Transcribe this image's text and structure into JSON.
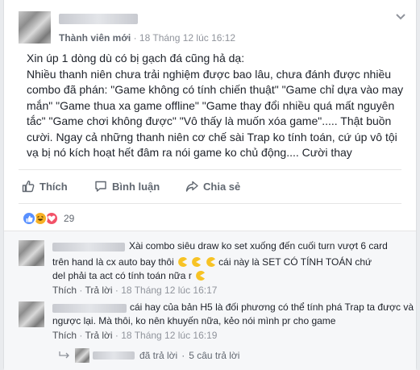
{
  "post": {
    "member_badge": "Thành viên mới",
    "timestamp": "· 18 Tháng 12 lúc 16:12",
    "lines": [
      "Xin úp 1 dòng dù có bị gạch đá cũng hả dạ:",
      "Nhiều thanh niên chưa trải nghiệm được bao lâu, chưa đánh được nhiều",
      "combo đã phán: \"Game không có tính chiến thuật\" \"Game chỉ dựa vào may",
      "mắn\" \"Game thua xa game offline\" \"Game thay đổi nhiều quá mất nguyên",
      "tắc\" \"Game chơi không được\" \"Vô thấy là muốn xóa game\"..... Thật buồn",
      "cười. Ngay cả những thanh niên cơ chế sài Trap ko tính toán, cứ úp vô tội",
      "vạ bị nó kích hoạt hết đâm ra nói game ko chủ động.... Cười thay"
    ]
  },
  "actions": {
    "like": "Thích",
    "comment": "Bình luận",
    "share": "Chia sẻ"
  },
  "reactions": {
    "count": "29",
    "colors": {
      "like": "#5890ff",
      "haha": "#f7b125",
      "love": "#f25268"
    }
  },
  "comments": [
    {
      "line1": "Xài combo siêu draw ko set xuống đến cuối turn vượt 6 card",
      "line2a": "trên hand là cx auto bay thôi",
      "line2b": "cái này là SET CÓ TÍNH TOÁN chứ",
      "line3": "del phải ta act có tính toán nữa r",
      "like": "Thích",
      "reply": "Trả lời",
      "time": "18 Tháng 12 lúc 16:17"
    },
    {
      "line1": "cái hay của bản H5 là đối phương có thể tính phá Trap ta được và",
      "line2": "ngược lại. Mà thôi, ko nên khuyến nữa, kẻo nói mình pr cho game",
      "like": "Thích",
      "reply": "Trả lời",
      "time": "18 Tháng 12 lúc 16:19"
    }
  ],
  "replies_summary": {
    "replied": "đã trả lời",
    "sep": "·",
    "count": "5 câu trả lời"
  }
}
